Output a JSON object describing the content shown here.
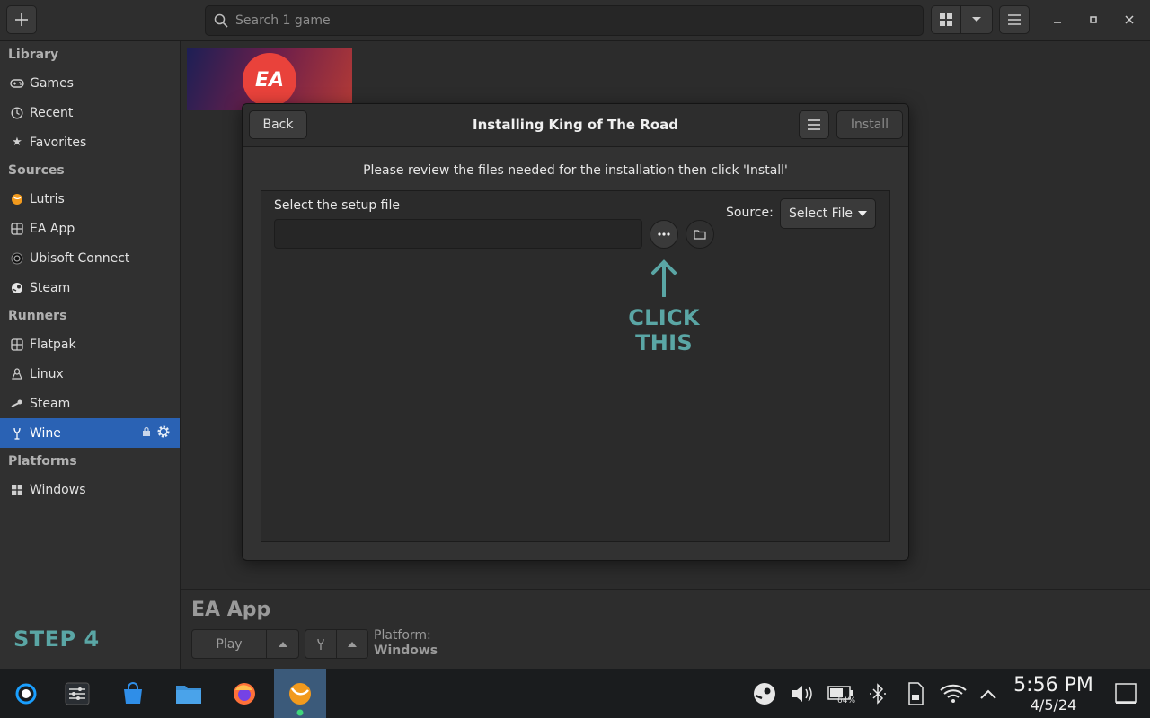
{
  "header": {
    "search_placeholder": "Search 1 game"
  },
  "sidebar": {
    "sections": [
      {
        "title": "Library",
        "items": [
          {
            "label": "Games",
            "icon": "gamepad-icon"
          },
          {
            "label": "Recent",
            "icon": "clock-icon"
          },
          {
            "label": "Favorites",
            "icon": "star-icon"
          }
        ]
      },
      {
        "title": "Sources",
        "items": [
          {
            "label": "Lutris",
            "icon": "lutris-icon"
          },
          {
            "label": "EA App",
            "icon": "ea-app-icon"
          },
          {
            "label": "Ubisoft Connect",
            "icon": "ubisoft-icon"
          },
          {
            "label": "Steam",
            "icon": "steam-icon"
          }
        ]
      },
      {
        "title": "Runners",
        "items": [
          {
            "label": "Flatpak",
            "icon": "flatpak-icon"
          },
          {
            "label": "Linux",
            "icon": "linux-icon"
          },
          {
            "label": "Steam",
            "icon": "steam-runner-icon"
          },
          {
            "label": "Wine",
            "icon": "wine-icon",
            "selected": true
          }
        ]
      },
      {
        "title": "Platforms",
        "items": [
          {
            "label": "Windows",
            "icon": "windows-icon"
          }
        ]
      }
    ],
    "step_label": "STEP 4"
  },
  "dialog": {
    "back_label": "Back",
    "title": "Installing King of The Road",
    "install_label": "Install",
    "review_text": "Please review the files needed for the installation then click 'Install'",
    "setup_label": "Select the setup file",
    "source_label": "Source:",
    "source_value": "Select File",
    "annotation": "CLICK THIS"
  },
  "game_bar": {
    "title": "EA App",
    "play_label": "Play",
    "platform_label": "Platform:",
    "platform_value": "Windows"
  },
  "taskbar": {
    "time": "5:56 PM",
    "date": "4/5/24",
    "battery": "64%"
  },
  "colors": {
    "accent": "#2a62b4",
    "annotation": "#5aa6a5",
    "ea_red": "#e9423b"
  }
}
